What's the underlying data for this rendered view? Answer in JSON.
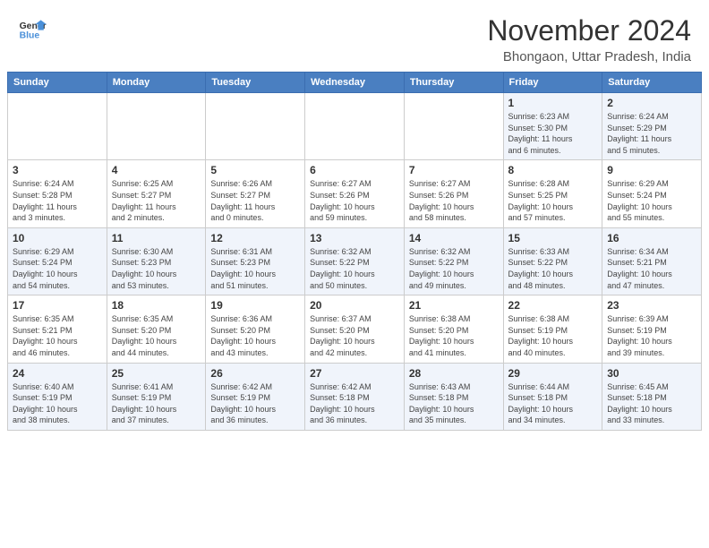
{
  "header": {
    "logo_line1": "General",
    "logo_line2": "Blue",
    "month": "November 2024",
    "location": "Bhongaon, Uttar Pradesh, India"
  },
  "days_of_week": [
    "Sunday",
    "Monday",
    "Tuesday",
    "Wednesday",
    "Thursday",
    "Friday",
    "Saturday"
  ],
  "weeks": [
    [
      {
        "num": "",
        "info": ""
      },
      {
        "num": "",
        "info": ""
      },
      {
        "num": "",
        "info": ""
      },
      {
        "num": "",
        "info": ""
      },
      {
        "num": "",
        "info": ""
      },
      {
        "num": "1",
        "info": "Sunrise: 6:23 AM\nSunset: 5:30 PM\nDaylight: 11 hours\nand 6 minutes."
      },
      {
        "num": "2",
        "info": "Sunrise: 6:24 AM\nSunset: 5:29 PM\nDaylight: 11 hours\nand 5 minutes."
      }
    ],
    [
      {
        "num": "3",
        "info": "Sunrise: 6:24 AM\nSunset: 5:28 PM\nDaylight: 11 hours\nand 3 minutes."
      },
      {
        "num": "4",
        "info": "Sunrise: 6:25 AM\nSunset: 5:27 PM\nDaylight: 11 hours\nand 2 minutes."
      },
      {
        "num": "5",
        "info": "Sunrise: 6:26 AM\nSunset: 5:27 PM\nDaylight: 11 hours\nand 0 minutes."
      },
      {
        "num": "6",
        "info": "Sunrise: 6:27 AM\nSunset: 5:26 PM\nDaylight: 10 hours\nand 59 minutes."
      },
      {
        "num": "7",
        "info": "Sunrise: 6:27 AM\nSunset: 5:26 PM\nDaylight: 10 hours\nand 58 minutes."
      },
      {
        "num": "8",
        "info": "Sunrise: 6:28 AM\nSunset: 5:25 PM\nDaylight: 10 hours\nand 57 minutes."
      },
      {
        "num": "9",
        "info": "Sunrise: 6:29 AM\nSunset: 5:24 PM\nDaylight: 10 hours\nand 55 minutes."
      }
    ],
    [
      {
        "num": "10",
        "info": "Sunrise: 6:29 AM\nSunset: 5:24 PM\nDaylight: 10 hours\nand 54 minutes."
      },
      {
        "num": "11",
        "info": "Sunrise: 6:30 AM\nSunset: 5:23 PM\nDaylight: 10 hours\nand 53 minutes."
      },
      {
        "num": "12",
        "info": "Sunrise: 6:31 AM\nSunset: 5:23 PM\nDaylight: 10 hours\nand 51 minutes."
      },
      {
        "num": "13",
        "info": "Sunrise: 6:32 AM\nSunset: 5:22 PM\nDaylight: 10 hours\nand 50 minutes."
      },
      {
        "num": "14",
        "info": "Sunrise: 6:32 AM\nSunset: 5:22 PM\nDaylight: 10 hours\nand 49 minutes."
      },
      {
        "num": "15",
        "info": "Sunrise: 6:33 AM\nSunset: 5:22 PM\nDaylight: 10 hours\nand 48 minutes."
      },
      {
        "num": "16",
        "info": "Sunrise: 6:34 AM\nSunset: 5:21 PM\nDaylight: 10 hours\nand 47 minutes."
      }
    ],
    [
      {
        "num": "17",
        "info": "Sunrise: 6:35 AM\nSunset: 5:21 PM\nDaylight: 10 hours\nand 46 minutes."
      },
      {
        "num": "18",
        "info": "Sunrise: 6:35 AM\nSunset: 5:20 PM\nDaylight: 10 hours\nand 44 minutes."
      },
      {
        "num": "19",
        "info": "Sunrise: 6:36 AM\nSunset: 5:20 PM\nDaylight: 10 hours\nand 43 minutes."
      },
      {
        "num": "20",
        "info": "Sunrise: 6:37 AM\nSunset: 5:20 PM\nDaylight: 10 hours\nand 42 minutes."
      },
      {
        "num": "21",
        "info": "Sunrise: 6:38 AM\nSunset: 5:20 PM\nDaylight: 10 hours\nand 41 minutes."
      },
      {
        "num": "22",
        "info": "Sunrise: 6:38 AM\nSunset: 5:19 PM\nDaylight: 10 hours\nand 40 minutes."
      },
      {
        "num": "23",
        "info": "Sunrise: 6:39 AM\nSunset: 5:19 PM\nDaylight: 10 hours\nand 39 minutes."
      }
    ],
    [
      {
        "num": "24",
        "info": "Sunrise: 6:40 AM\nSunset: 5:19 PM\nDaylight: 10 hours\nand 38 minutes."
      },
      {
        "num": "25",
        "info": "Sunrise: 6:41 AM\nSunset: 5:19 PM\nDaylight: 10 hours\nand 37 minutes."
      },
      {
        "num": "26",
        "info": "Sunrise: 6:42 AM\nSunset: 5:19 PM\nDaylight: 10 hours\nand 36 minutes."
      },
      {
        "num": "27",
        "info": "Sunrise: 6:42 AM\nSunset: 5:18 PM\nDaylight: 10 hours\nand 36 minutes."
      },
      {
        "num": "28",
        "info": "Sunrise: 6:43 AM\nSunset: 5:18 PM\nDaylight: 10 hours\nand 35 minutes."
      },
      {
        "num": "29",
        "info": "Sunrise: 6:44 AM\nSunset: 5:18 PM\nDaylight: 10 hours\nand 34 minutes."
      },
      {
        "num": "30",
        "info": "Sunrise: 6:45 AM\nSunset: 5:18 PM\nDaylight: 10 hours\nand 33 minutes."
      }
    ]
  ]
}
